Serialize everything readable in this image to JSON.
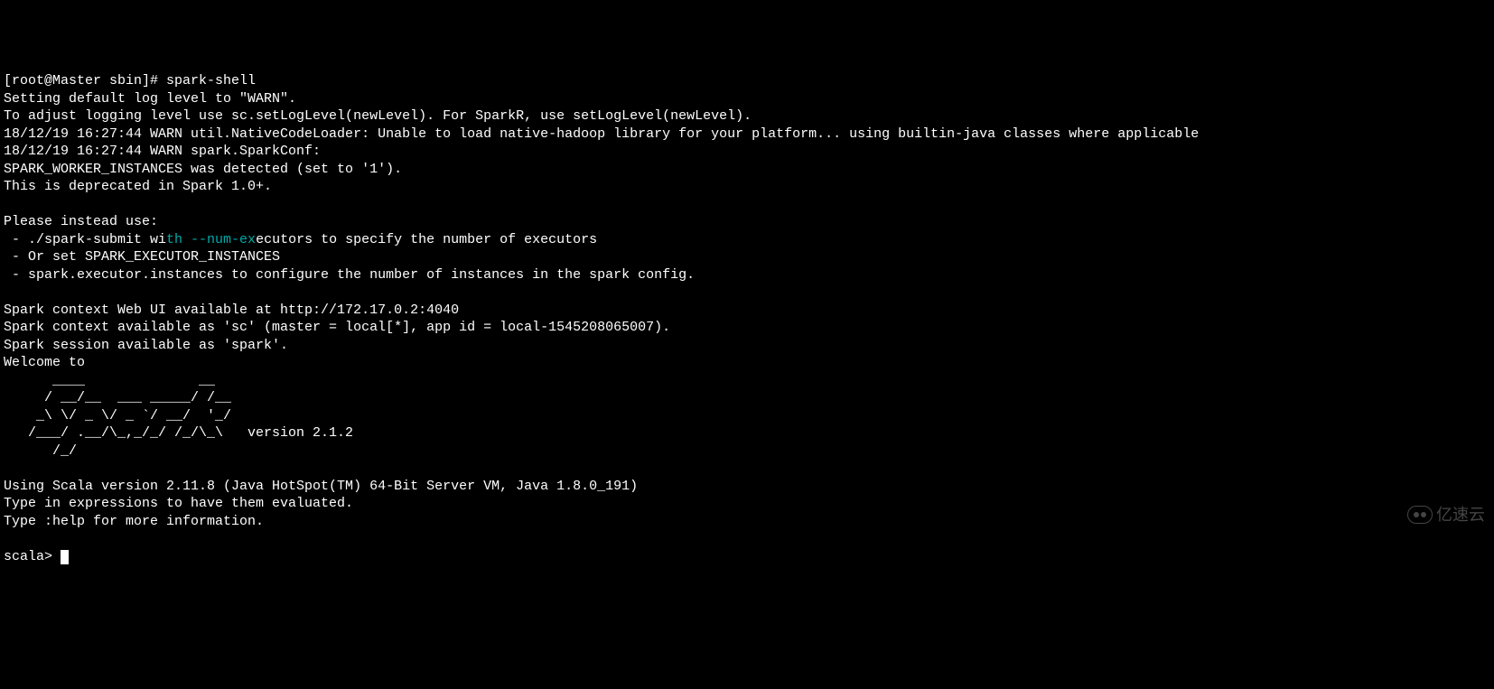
{
  "terminal": {
    "prompt": "[root@Master sbin]# ",
    "cmd": "spark-shell",
    "l1": "Setting default log level to \"WARN\".",
    "l2": "To adjust logging level use sc.setLogLevel(newLevel). For SparkR, use setLogLevel(newLevel).",
    "l3": "18/12/19 16:27:44 WARN util.NativeCodeLoader: Unable to load native-hadoop library for your platform... using builtin-java classes where applicable",
    "l4": "18/12/19 16:27:44 WARN spark.SparkConf:",
    "l5": "SPARK_WORKER_INSTANCES was detected (set to '1').",
    "l6": "This is deprecated in Spark 1.0+.",
    "l7": "",
    "l8": "Please instead use:",
    "l9a": " - ./spark-submit wi",
    "l9b": "th --num-ex",
    "l9c": "ecutors to specify the number of executors",
    "l10": " - Or set SPARK_EXECUTOR_INSTANCES",
    "l11": " - spark.executor.instances to configure the number of instances in the spark config.",
    "l12": "",
    "l13": "Spark context Web UI available at http://172.17.0.2:4040",
    "l14": "Spark context available as 'sc' (master = local[*], app id = local-1545208065007).",
    "l15": "Spark session available as 'spark'.",
    "l16": "Welcome to",
    "ascii1": "      ____              __",
    "ascii2": "     / __/__  ___ _____/ /__",
    "ascii3": "    _\\ \\/ _ \\/ _ `/ __/  '_/",
    "ascii4": "   /___/ .__/\\_,_/_/ /_/\\_\\   version 2.1.2",
    "ascii5": "      /_/",
    "l17": "",
    "l18": "Using Scala version 2.11.8 (Java HotSpot(TM) 64-Bit Server VM, Java 1.8.0_191)",
    "l19": "Type in expressions to have them evaluated.",
    "l20": "Type :help for more information.",
    "l21": "",
    "scala_prompt": "scala> "
  },
  "watermark": {
    "text": "亿速云"
  }
}
